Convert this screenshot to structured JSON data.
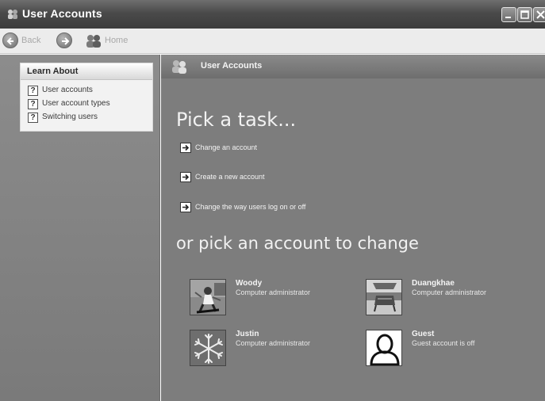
{
  "window": {
    "title": "User Accounts"
  },
  "toolbar": {
    "back_label": "Back",
    "home_label": "Home"
  },
  "sidebar": {
    "learn_about": {
      "title": "Learn About",
      "items": [
        {
          "label": "User accounts",
          "icon": "help-icon"
        },
        {
          "label": "User account types",
          "icon": "help-icon"
        },
        {
          "label": "Switching users",
          "icon": "help-icon"
        }
      ]
    }
  },
  "main": {
    "header_title": "User Accounts",
    "pick_task_heading": "Pick a task...",
    "tasks": [
      {
        "label": "Change an account"
      },
      {
        "label": "Create a new account"
      },
      {
        "label": "Change the way users log on or off"
      }
    ],
    "pick_account_heading": "or pick an account to change",
    "accounts": [
      {
        "name": "Woody",
        "type": "Computer administrator",
        "picture": "skateboarder"
      },
      {
        "name": "Duangkhae",
        "type": "Computer administrator",
        "picture": "beach-chair"
      },
      {
        "name": "Justin",
        "type": "Computer administrator",
        "picture": "snowflake"
      },
      {
        "name": "Guest",
        "type": "Guest account is off",
        "picture": "guest-silhouette"
      }
    ]
  }
}
